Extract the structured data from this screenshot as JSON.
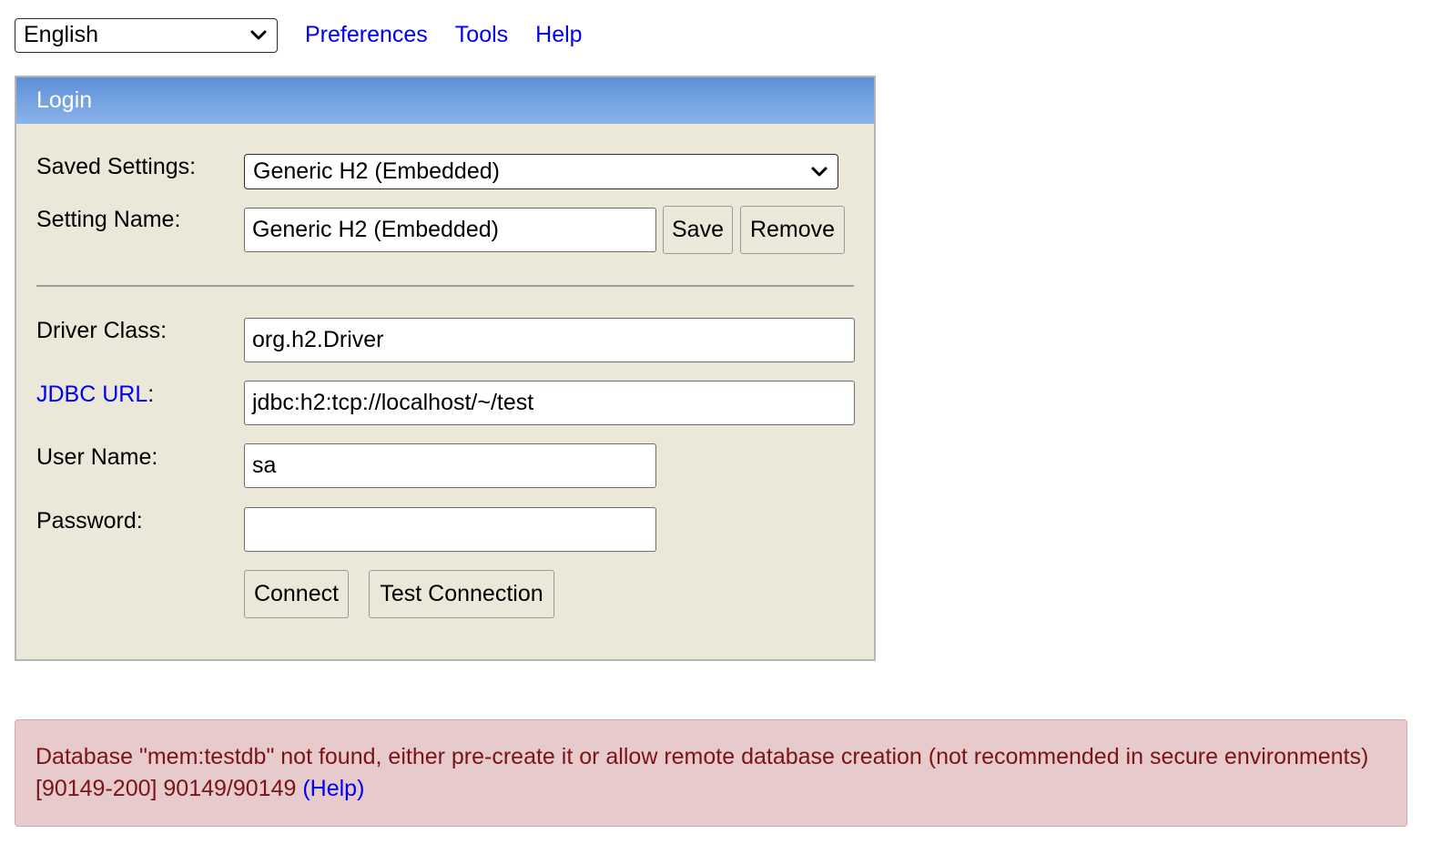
{
  "top": {
    "language_selected": "English",
    "links": [
      "Preferences",
      "Tools",
      "Help"
    ]
  },
  "login": {
    "title": "Login",
    "saved_settings_label": "Saved Settings:",
    "saved_settings_value": "Generic H2 (Embedded)",
    "setting_name_label": "Setting Name:",
    "setting_name_value": "Generic H2 (Embedded)",
    "save_label": "Save",
    "remove_label": "Remove",
    "driver_class_label": "Driver Class:",
    "driver_class_value": "org.h2.Driver",
    "jdbc_url_link": "JDBC URL",
    "jdbc_url_colon": ":",
    "jdbc_url_value": "jdbc:h2:tcp://localhost/~/test",
    "user_name_label": "User Name:",
    "user_name_value": "sa",
    "password_label": "Password:",
    "password_value": "",
    "connect_label": "Connect",
    "test_connection_label": "Test Connection"
  },
  "error": {
    "message": "Database \"mem:testdb\" not found, either pre-create it or allow remote database creation (not recommended in secure environments) [90149-200] 90149/90149 ",
    "help_link": "(Help)"
  },
  "colors": {
    "link": "#0000ee",
    "panel_bg": "#ebe8da",
    "header_gradient_top": "#5d8fd8",
    "header_gradient_bottom": "#8ab3ea",
    "error_bg": "#e7cacb",
    "error_text": "#7b1416"
  },
  "icons": {
    "dropdown": "chevron-down-icon"
  }
}
